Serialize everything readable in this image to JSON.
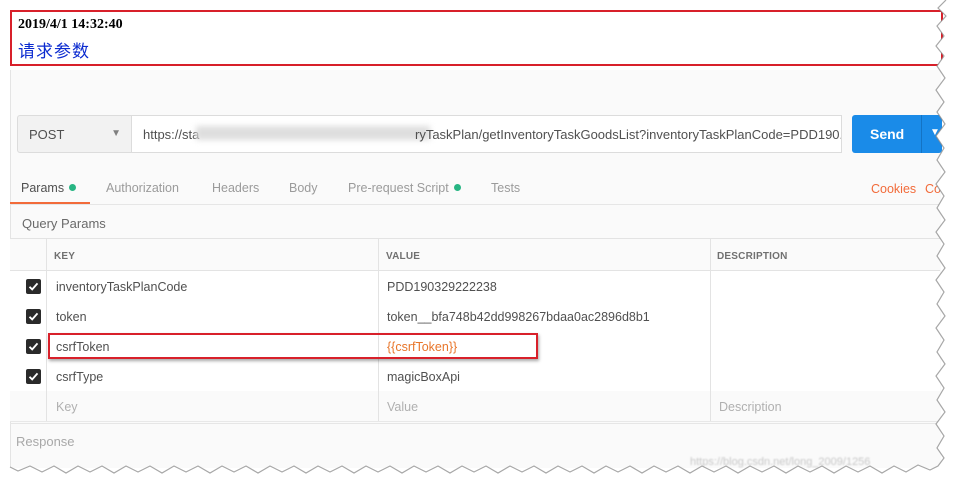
{
  "annotation": {
    "timestamp": "2019/4/1 14:32:40",
    "title": "请求参数"
  },
  "request": {
    "method": "POST",
    "url_prefix": "https://sta",
    "url_suffix": "ryTaskPlan/getInventoryTaskGoodsList?inventoryTaskPlanCode=PDD190...",
    "send_label": "Send"
  },
  "tabs": [
    {
      "label": "Params",
      "has_dot": true,
      "active": true
    },
    {
      "label": "Authorization"
    },
    {
      "label": "Headers"
    },
    {
      "label": "Body"
    },
    {
      "label": "Pre-request Script",
      "has_dot": true
    },
    {
      "label": "Tests"
    }
  ],
  "links": {
    "cookies": "Cookies",
    "code": "Co"
  },
  "query_params": {
    "label": "Query Params",
    "headers": {
      "key": "KEY",
      "value": "VALUE",
      "description": "DESCRIPTION"
    },
    "rows": [
      {
        "checked": true,
        "key": "inventoryTaskPlanCode",
        "value": "PDD190329222238",
        "description": ""
      },
      {
        "checked": true,
        "key": "token",
        "value": "token__bfa748b42dd998267bdaa0ac2896d8b1",
        "description": ""
      },
      {
        "checked": true,
        "key": "csrfToken",
        "value": "{{csrfToken}}",
        "description": ""
      },
      {
        "checked": true,
        "key": "csrfType",
        "value": "magicBoxApi",
        "description": ""
      }
    ],
    "placeholders": {
      "key": "Key",
      "value": "Value",
      "description": "Description"
    }
  },
  "response_label": "Response",
  "watermark": "https://blog.csdn.net/long_2009/1256",
  "colors": {
    "accent": "#f26b3a",
    "send": "#1a8be8",
    "dot": "#27b583",
    "variable": "#e8762b",
    "highlight": "#d8202a",
    "annotation_title": "#0b2bd0"
  }
}
